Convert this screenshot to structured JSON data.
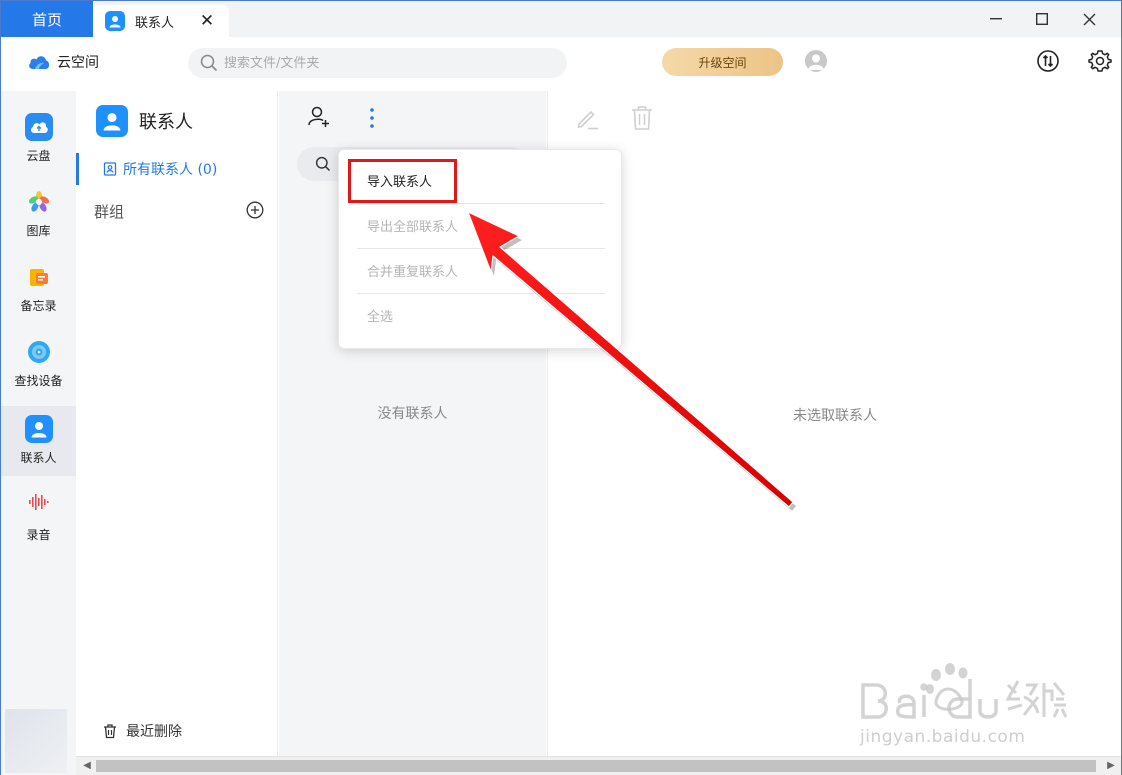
{
  "titlebar": {
    "home_tab": "首页",
    "active_tab": "联系人"
  },
  "header": {
    "brand": "云空间",
    "search_placeholder": "搜索文件/文件夹",
    "upgrade_label": "升级空间"
  },
  "leftnav": {
    "items": [
      {
        "label": "云盘",
        "icon": "cloud-drive-icon",
        "color": "#2a8cf0"
      },
      {
        "label": "图库",
        "icon": "gallery-icon",
        "color": "#f39b2a"
      },
      {
        "label": "备忘录",
        "icon": "memo-icon",
        "color": "#f7b500"
      },
      {
        "label": "查找设备",
        "icon": "find-device-icon",
        "color": "#30a8f0"
      },
      {
        "label": "联系人",
        "icon": "contacts-icon",
        "color": "#1f90ff"
      },
      {
        "label": "录音",
        "icon": "recorder-icon",
        "color": "#f04848"
      }
    ],
    "active": "联系人"
  },
  "contacts_panel": {
    "title": "联系人",
    "all_contacts": "所有联系人 (0)",
    "groups": "群组",
    "recently_deleted": "最近删除"
  },
  "list_panel": {
    "empty_text": "没有联系人"
  },
  "detail_panel": {
    "empty_text": "未选取联系人"
  },
  "menu": {
    "items": [
      {
        "label": "导入联系人",
        "enabled": true
      },
      {
        "label": "导出全部联系人",
        "enabled": false
      },
      {
        "label": "合并重复联系人",
        "enabled": false
      },
      {
        "label": "全选",
        "enabled": false
      }
    ]
  },
  "watermark": {
    "url": "jingyan.baidu.com",
    "logo_text": "Baidu经验"
  },
  "colors": {
    "accent": "#2478e8",
    "highlight": "#e11818"
  }
}
